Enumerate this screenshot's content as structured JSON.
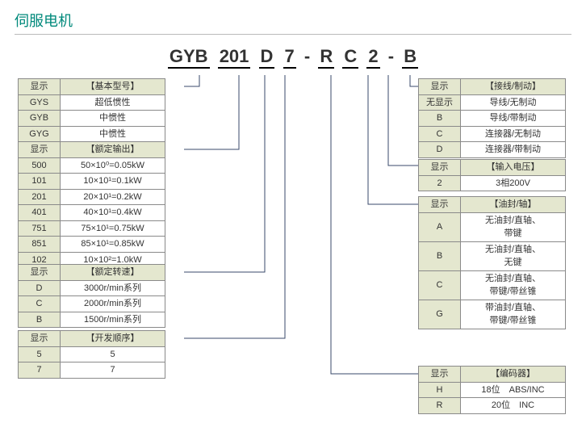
{
  "title": "伺服电机",
  "model": {
    "segs": [
      "GYB",
      "201",
      "D",
      "7",
      "-",
      "R",
      "C",
      "2",
      "-",
      "B"
    ]
  },
  "tables": {
    "basic": {
      "head1": "显示",
      "head2": "【基本型号】",
      "rows": [
        [
          "GYS",
          "超低惯性"
        ],
        [
          "GYB",
          "中惯性"
        ],
        [
          "GYG",
          "中惯性"
        ]
      ]
    },
    "output": {
      "head1": "显示",
      "head2": "【额定输出】",
      "rows": [
        [
          "500",
          "50×10⁰=0.05kW"
        ],
        [
          "101",
          "10×10¹=0.1kW"
        ],
        [
          "201",
          "20×10¹=0.2kW"
        ],
        [
          "401",
          "40×10¹=0.4kW"
        ],
        [
          "751",
          "75×10¹=0.75kW"
        ],
        [
          "851",
          "85×10¹=0.85kW"
        ],
        [
          "102",
          "10×10²=1.0kW"
        ]
      ]
    },
    "speed": {
      "head1": "显示",
      "head2": "【额定转速】",
      "rows": [
        [
          "D",
          "3000r/min系列"
        ],
        [
          "C",
          "2000r/min系列"
        ],
        [
          "B",
          "1500r/min系列"
        ]
      ]
    },
    "devseq": {
      "head1": "显示",
      "head2": "【开发顺序】",
      "rows": [
        [
          "5",
          "5"
        ],
        [
          "7",
          "7"
        ]
      ]
    },
    "conn": {
      "head1": "显示",
      "head2": "【接线/制动】",
      "rows": [
        [
          "无显示",
          "导线/无制动"
        ],
        [
          "B",
          "导线/带制动"
        ],
        [
          "C",
          "连接器/无制动"
        ],
        [
          "D",
          "连接器/带制动"
        ]
      ]
    },
    "volt": {
      "head1": "显示",
      "head2": "【输入电压】",
      "rows": [
        [
          "2",
          "3相200V"
        ]
      ]
    },
    "shaft": {
      "head1": "显示",
      "head2": "【油封/轴】",
      "rows": [
        [
          "A",
          "无油封/直轴、\n带键"
        ],
        [
          "B",
          "无油封/直轴、\n无键"
        ],
        [
          "C",
          "无油封/直轴、\n带键/带丝锥"
        ],
        [
          "G",
          "带油封/直轴、\n带键/带丝锥"
        ]
      ]
    },
    "enc": {
      "head1": "显示",
      "head2": "【编码器】",
      "rows": [
        [
          "H",
          "18位　ABS/INC"
        ],
        [
          "R",
          "20位　INC"
        ]
      ]
    }
  }
}
